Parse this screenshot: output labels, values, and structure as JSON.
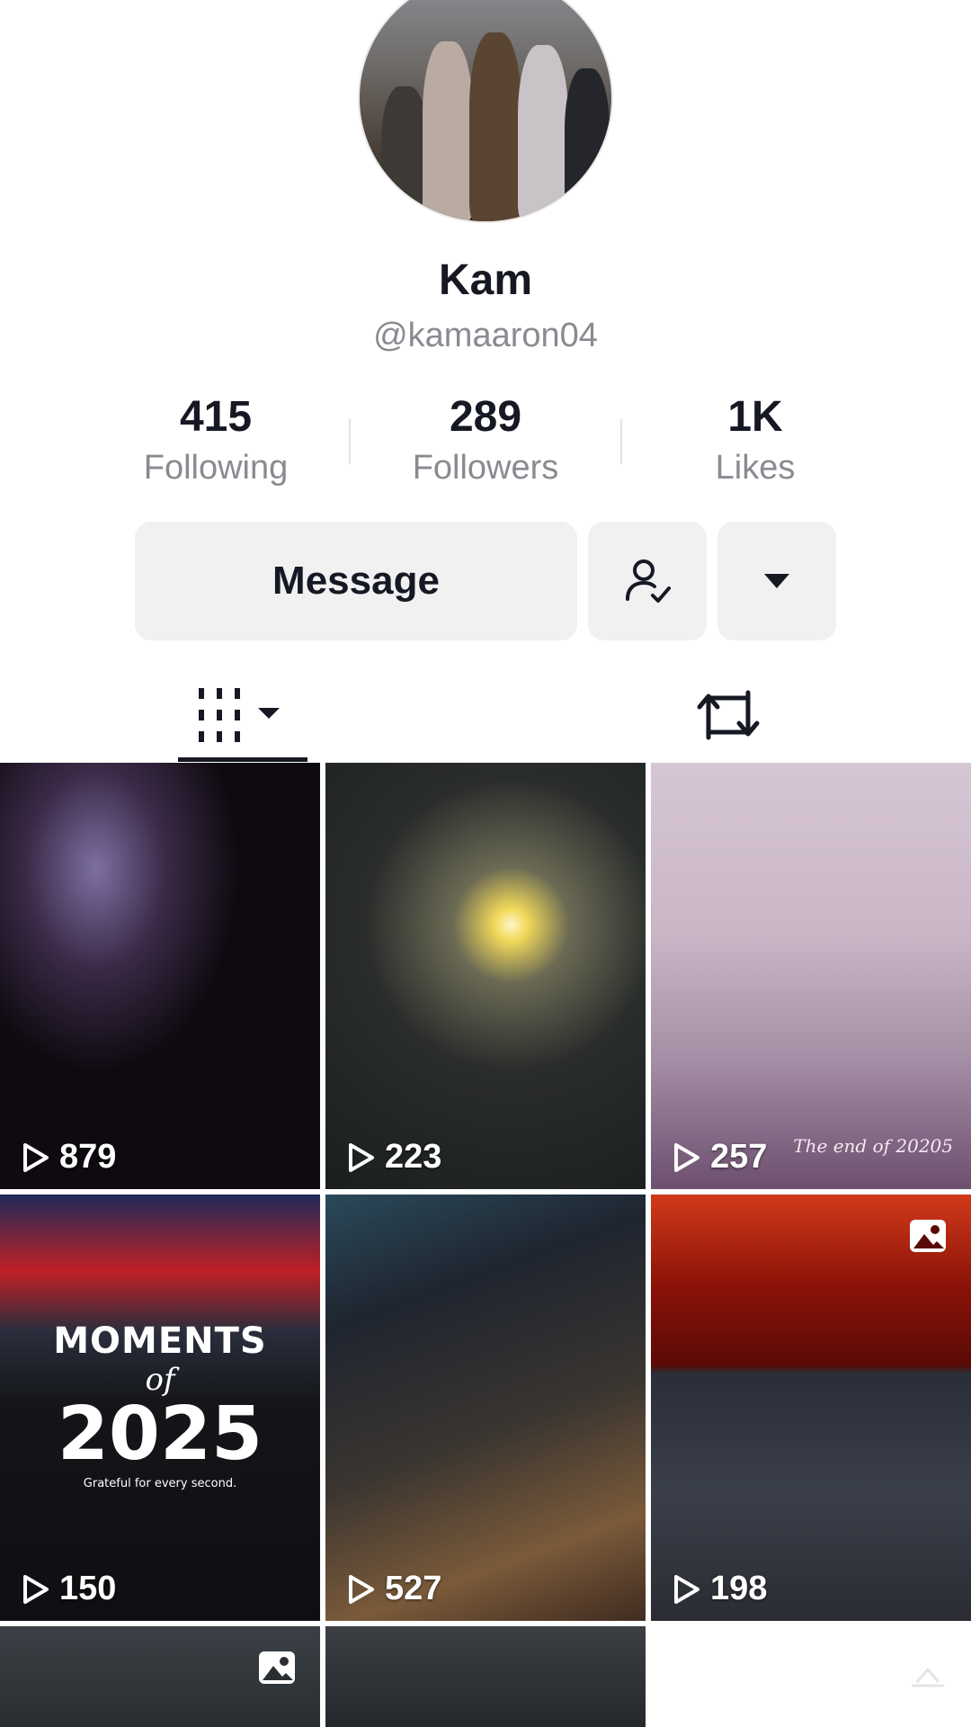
{
  "profile": {
    "name": "Kam",
    "handle": "@kamaaron04"
  },
  "stats": [
    {
      "value": "415",
      "label": "Following"
    },
    {
      "value": "289",
      "label": "Followers"
    },
    {
      "value": "1K",
      "label": "Likes"
    }
  ],
  "actions": {
    "message_label": "Message",
    "following_icon": "user-check-icon",
    "more_icon": "caret-down-icon"
  },
  "tabs": [
    {
      "icon": "videos-grid-icon",
      "active": true
    },
    {
      "icon": "repost-icon",
      "active": false
    }
  ],
  "grid": [
    {
      "views": "879",
      "kind": "video"
    },
    {
      "views": "223",
      "kind": "video"
    },
    {
      "views": "257",
      "kind": "video",
      "caption": "The end of 20205"
    },
    {
      "views": "150",
      "kind": "video",
      "overlay": {
        "line1": "MOMENTS",
        "line2": "of",
        "line3": "2025",
        "line4": "Grateful for every second."
      }
    },
    {
      "views": "527",
      "kind": "video"
    },
    {
      "views": "198",
      "kind": "photo"
    },
    {
      "kind": "photo"
    },
    {
      "kind": "video"
    },
    {
      "kind": "empty"
    }
  ]
}
